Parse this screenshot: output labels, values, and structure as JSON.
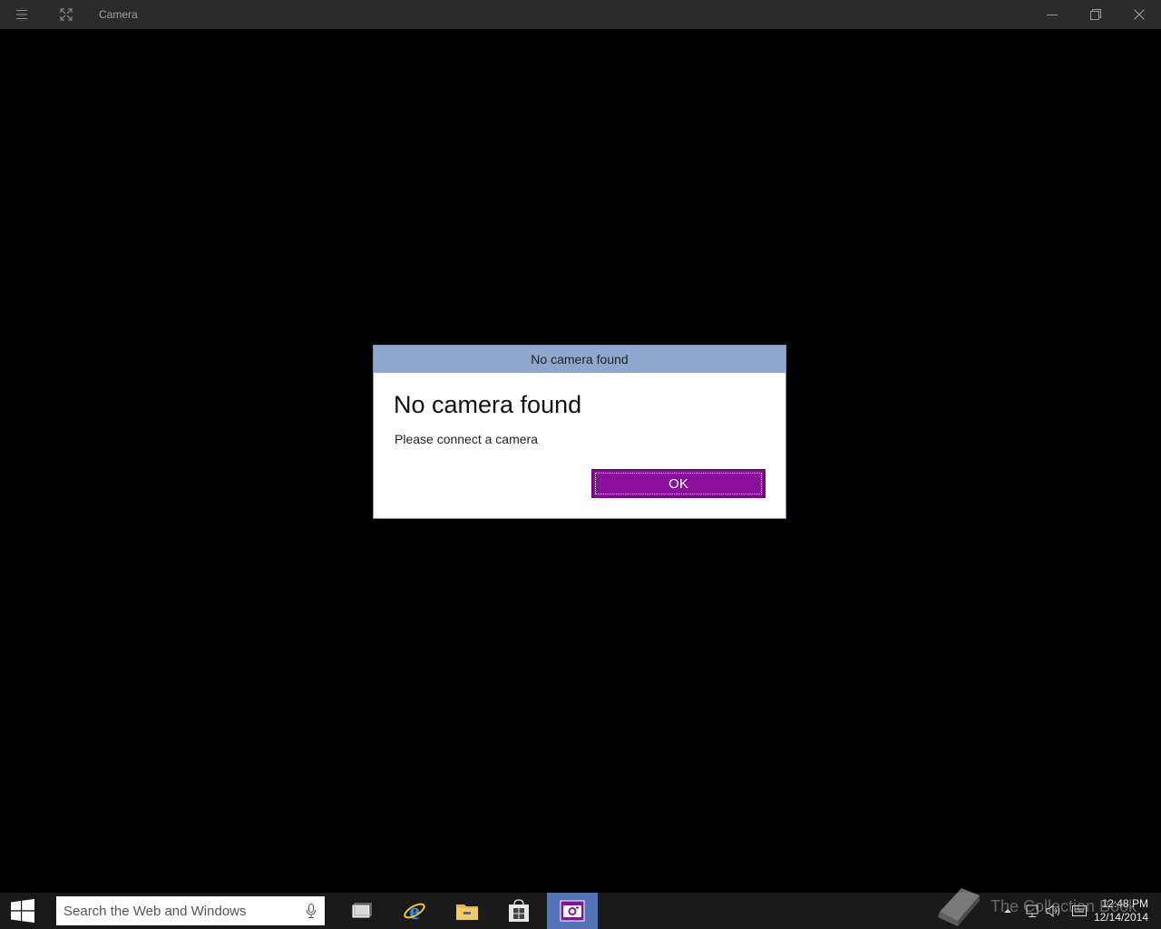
{
  "window": {
    "title": "Camera",
    "menu_icon": "hamburger-icon",
    "fullscreen_icon": "expand-icon",
    "minimize_icon": "minimize-icon",
    "restore_icon": "restore-icon",
    "close_icon": "close-icon"
  },
  "dialog": {
    "header": "No camera found",
    "heading": "No camera found",
    "message": "Please connect a camera",
    "ok_label": "OK",
    "accent_color": "#8a0f9a",
    "header_color": "#8fa6cd"
  },
  "taskbar": {
    "start_icon": "windows-logo-icon",
    "search_placeholder": "Search the Web and Windows",
    "mic_icon": "microphone-icon",
    "apps": [
      {
        "name": "Task View",
        "icon": "task-view-icon"
      },
      {
        "name": "Internet Explorer",
        "icon": "internet-explorer-icon"
      },
      {
        "name": "File Explorer",
        "icon": "file-explorer-icon"
      },
      {
        "name": "Store",
        "icon": "store-icon"
      },
      {
        "name": "Camera",
        "icon": "camera-icon",
        "active": true
      }
    ],
    "tray": {
      "show_hidden_icon": "chevron-up-icon",
      "network_icon": "network-icon",
      "volume_icon": "volume-icon",
      "notifications_icon": "action-center-icon"
    },
    "clock": {
      "time": "12:48 PM",
      "date": "12/14/2014"
    }
  },
  "watermark": {
    "text": "The Collection Book",
    "icon": "book-icon"
  }
}
